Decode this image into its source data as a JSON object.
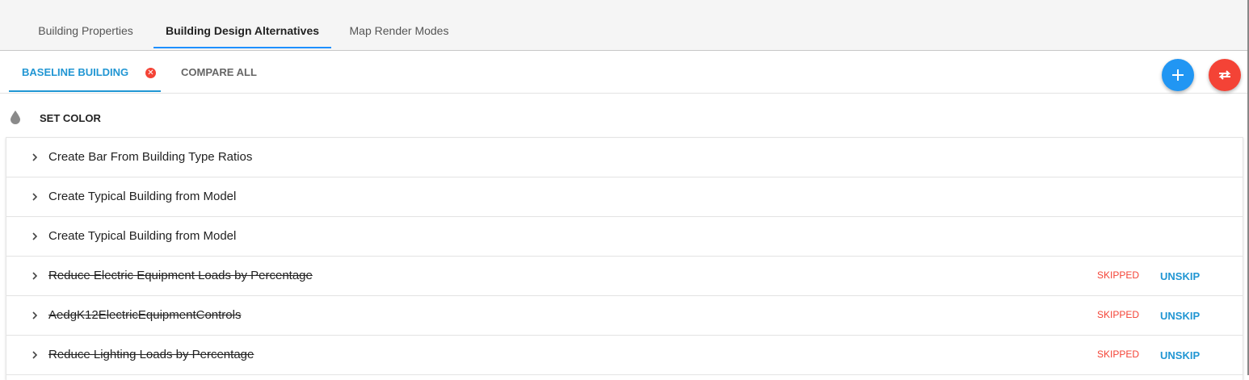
{
  "top_tabs": [
    {
      "label": "Building Properties",
      "active": false
    },
    {
      "label": "Building Design Alternatives",
      "active": true
    },
    {
      "label": "Map Render Modes",
      "active": false
    }
  ],
  "sub_tabs": [
    {
      "label": "BASELINE BUILDING",
      "active": true
    },
    {
      "label": "COMPARE ALL",
      "active": false
    }
  ],
  "fabs": {
    "add_icon": "plus-icon",
    "swap_icon": "swap-arrows-icon"
  },
  "set_color": {
    "label": "SET COLOR",
    "icon": "drop-icon"
  },
  "measures": [
    {
      "title": "Create Bar From Building Type Ratios",
      "skipped": false,
      "status": "",
      "action": ""
    },
    {
      "title": "Create Typical Building from Model",
      "skipped": false,
      "status": "",
      "action": ""
    },
    {
      "title": "Create Typical Building from Model",
      "skipped": false,
      "status": "",
      "action": ""
    },
    {
      "title": "Reduce Electric Equipment Loads by Percentage",
      "skipped": true,
      "status": "SKIPPED",
      "action": "UNSKIP"
    },
    {
      "title": "AedgK12ElectricEquipmentControls",
      "skipped": true,
      "status": "SKIPPED",
      "action": "UNSKIP"
    },
    {
      "title": "Reduce Lighting Loads by Percentage",
      "skipped": true,
      "status": "SKIPPED",
      "action": "UNSKIP"
    }
  ],
  "colors": {
    "accent_blue": "#2196d3",
    "fab_blue": "#2196f3",
    "danger_red": "#f44336"
  }
}
